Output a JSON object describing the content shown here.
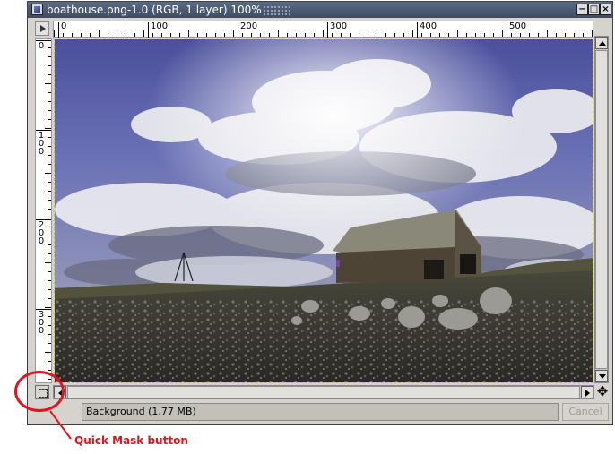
{
  "window": {
    "title": "boathouse.png-1.0 (RGB, 1 layer) 100%",
    "controls": {
      "minimize": "−",
      "maximize": "□",
      "close": "×"
    }
  },
  "rulers": {
    "horizontal_labels": [
      "0",
      "100",
      "200",
      "300",
      "400",
      "500"
    ],
    "vertical_labels": [
      "0",
      "100",
      "200",
      "300"
    ]
  },
  "image": {
    "description_icon": "boathouse-photo"
  },
  "status": {
    "text": "Background (1.77 MB)",
    "cancel_label": "Cancel"
  },
  "annotation": {
    "label": "Quick Mask button",
    "color": "#e0141e"
  },
  "icons": {
    "menu": "menu-arrow-icon",
    "quick_mask": "quick-mask-icon",
    "navigate": "navigate-icon"
  },
  "colors": {
    "titlebar": "#4a5872",
    "chrome": "#d6d3ce",
    "selection_border": "#d4c21a"
  }
}
